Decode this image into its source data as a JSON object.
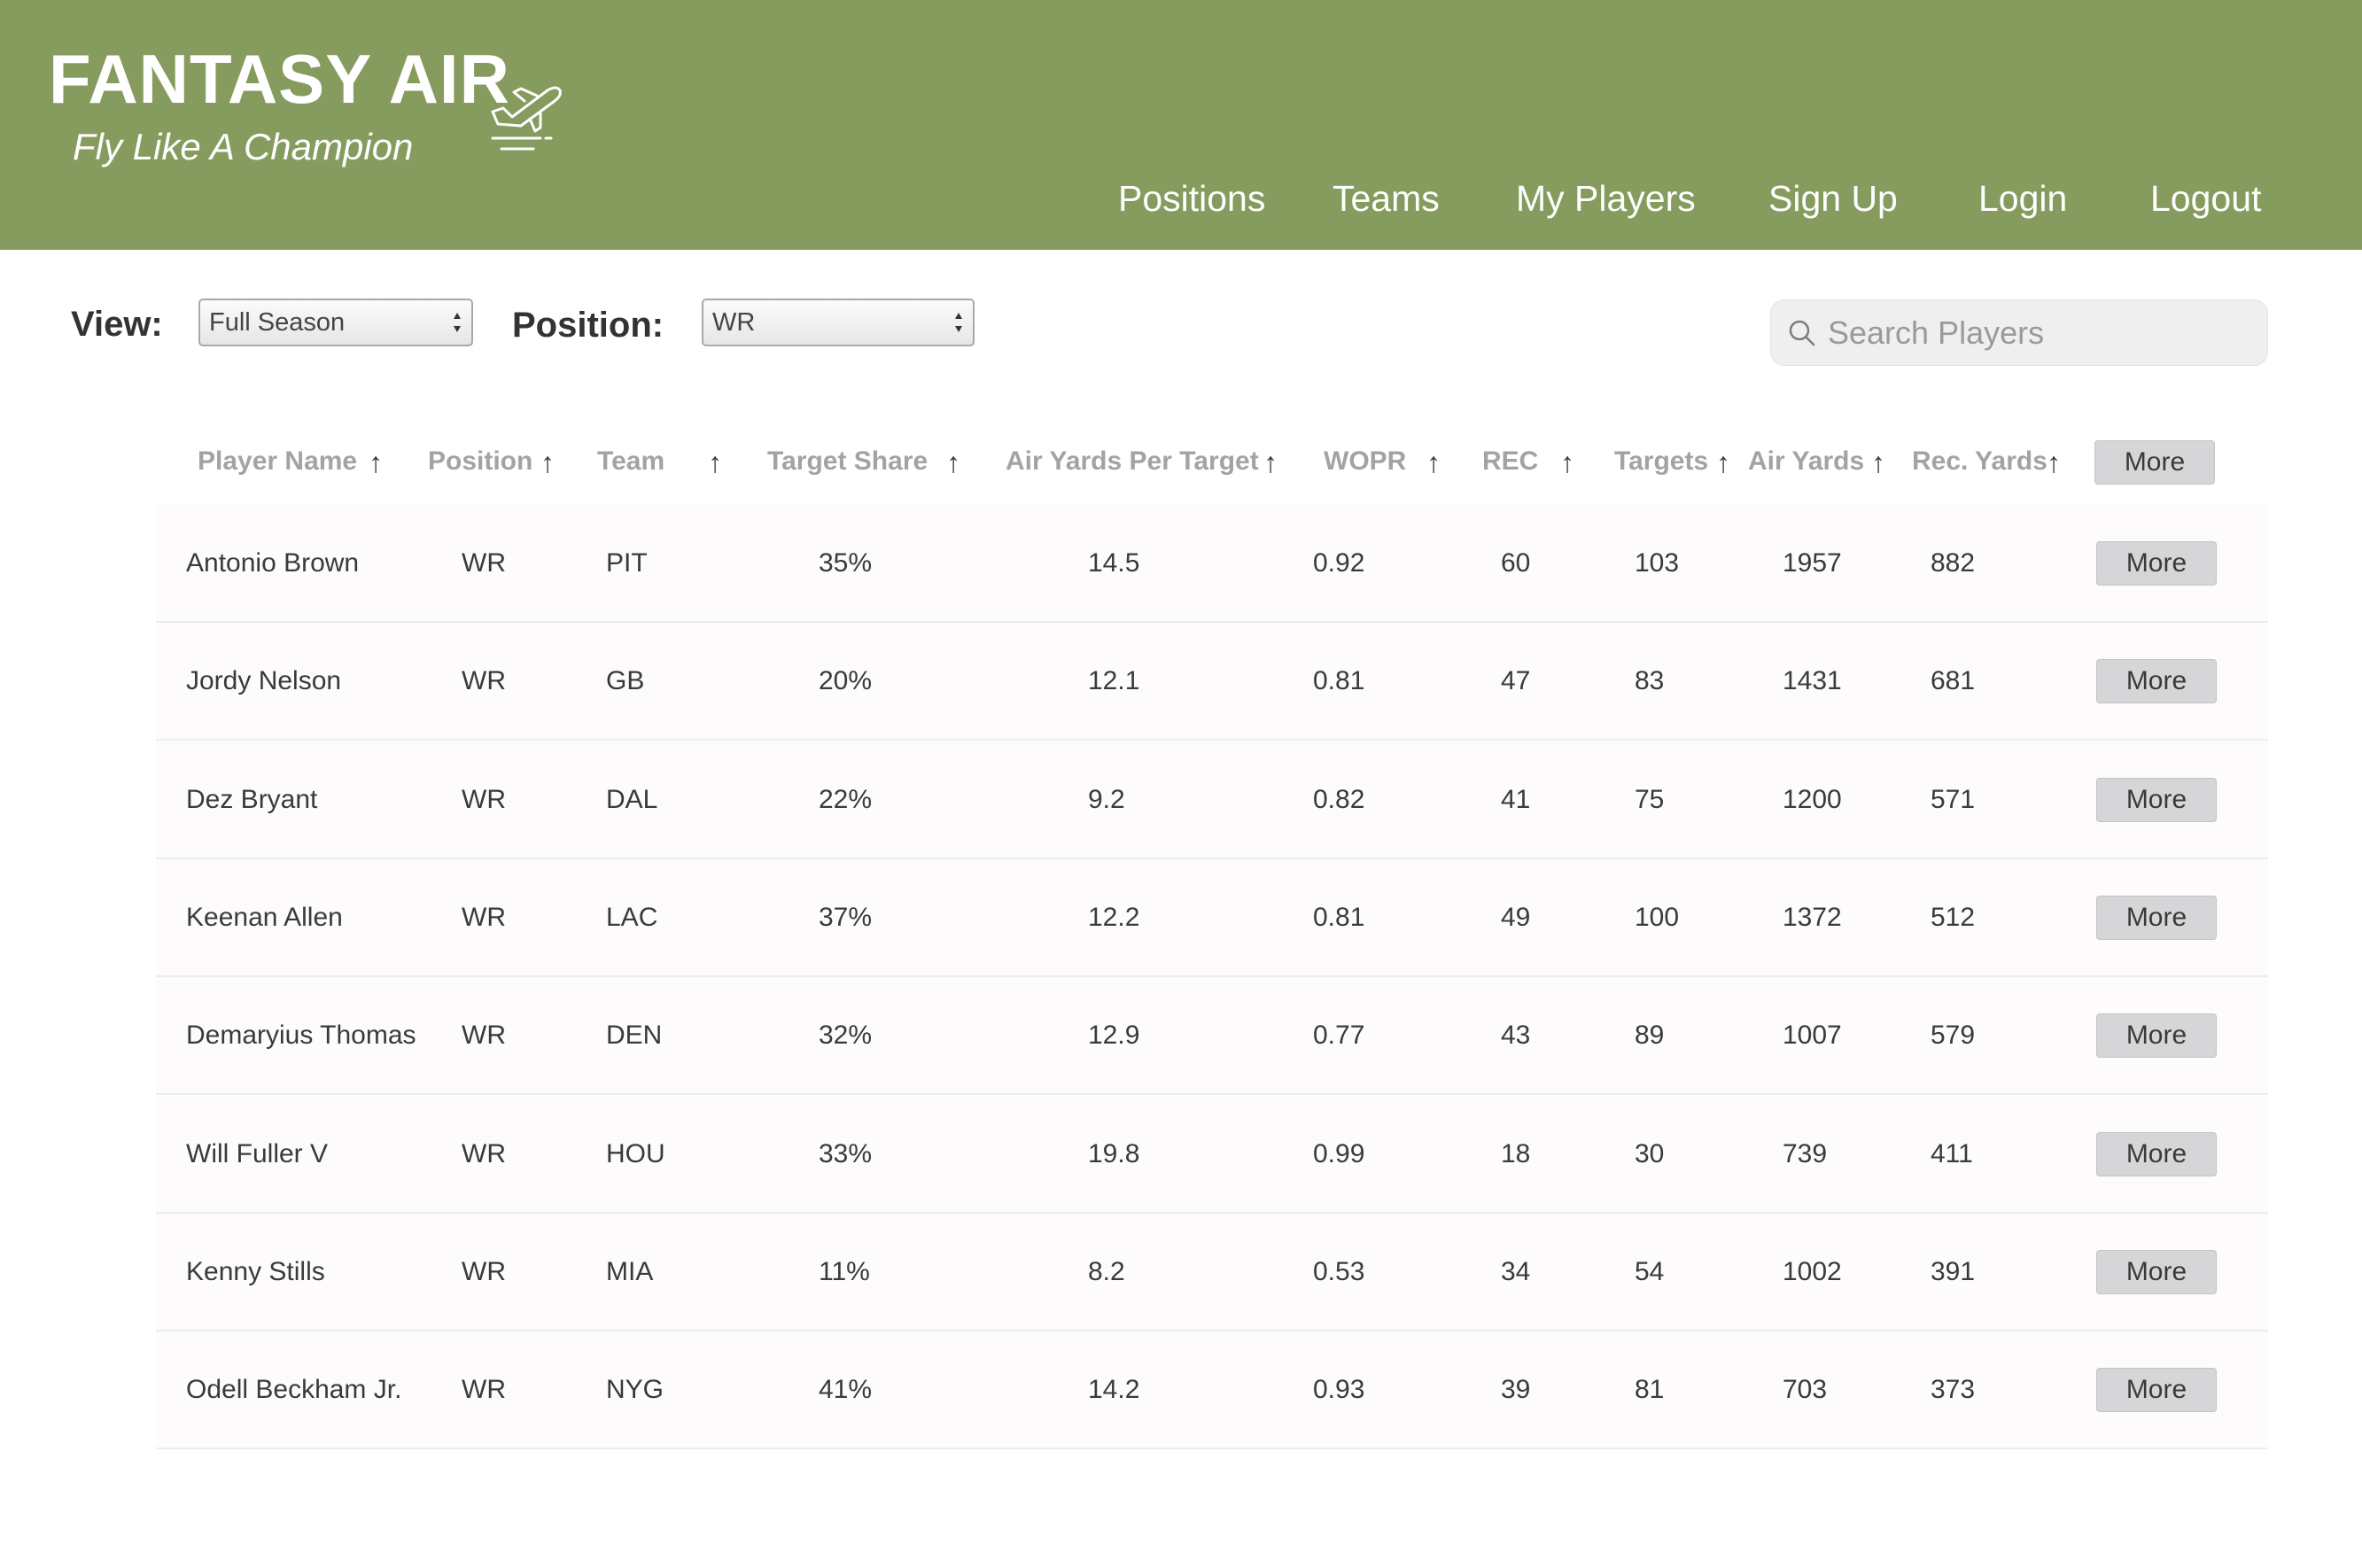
{
  "brand": {
    "title": "FANTASY AIR",
    "tagline": "Fly Like A Champion"
  },
  "nav": [
    "Positions",
    "Teams",
    "My Players",
    "Sign Up",
    "Login",
    "Logout"
  ],
  "controls": {
    "view_label": "View:",
    "view_value": "Full Season",
    "position_label": "Position:",
    "position_value": "WR",
    "search_placeholder": "Search Players"
  },
  "table": {
    "columns": [
      "Player Name",
      "Position",
      "Team",
      "Target Share",
      "Air Yards Per Target",
      "WOPR",
      "REC",
      "Targets",
      "Air Yards",
      "Rec. Yards"
    ],
    "sort_glyph": "↑",
    "more_label": "More",
    "rows": [
      [
        "Antonio Brown",
        "WR",
        "PIT",
        "35%",
        "14.5",
        "0.92",
        "60",
        "103",
        "1957",
        "882"
      ],
      [
        "Jordy Nelson",
        "WR",
        "GB",
        "20%",
        "12.1",
        "0.81",
        "47",
        "83",
        "1431",
        "681"
      ],
      [
        "Dez Bryant",
        "WR",
        "DAL",
        "22%",
        "9.2",
        "0.82",
        "41",
        "75",
        "1200",
        "571"
      ],
      [
        "Keenan Allen",
        "WR",
        "LAC",
        "37%",
        "12.2",
        "0.81",
        "49",
        "100",
        "1372",
        "512"
      ],
      [
        "Demaryius Thomas",
        "WR",
        "DEN",
        "32%",
        "12.9",
        "0.77",
        "43",
        "89",
        "1007",
        "579"
      ],
      [
        "Will Fuller V",
        "WR",
        "HOU",
        "33%",
        "19.8",
        "0.99",
        "18",
        "30",
        "739",
        "411"
      ],
      [
        "Kenny Stills",
        "WR",
        "MIA",
        "11%",
        "8.2",
        "0.53",
        "34",
        "54",
        "1002",
        "391"
      ],
      [
        "Odell Beckham Jr.",
        "WR",
        "NYG",
        "41%",
        "14.2",
        "0.93",
        "39",
        "81",
        "703",
        "373"
      ]
    ]
  },
  "colors": {
    "header_bg": "#869b5e",
    "header_text": "#ffffff",
    "button_bg": "#d6d6d8",
    "column_header_text": "#a3a3a3"
  },
  "icons": {
    "logo": "airplane-takeoff-icon",
    "search": "search-icon",
    "select": "select-arrows-icon",
    "sort": "sort-up-arrow-icon"
  }
}
